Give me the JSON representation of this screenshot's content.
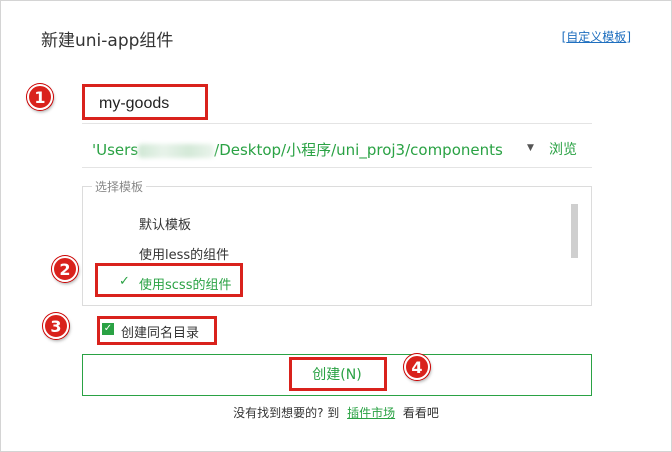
{
  "dialog": {
    "title": "新建uni-app组件",
    "custom_template_link": "自定义模板"
  },
  "component_name": {
    "value": "my-goods",
    "placeholder": ""
  },
  "location": {
    "path_prefix": "'Users",
    "path_suffix": "/Desktop/小程序/uni_proj3/components",
    "browse_label": "浏览"
  },
  "templates": {
    "legend": "选择模板",
    "items": [
      {
        "label": "默认模板",
        "selected": false
      },
      {
        "label": "使用less的组件",
        "selected": false
      },
      {
        "label": "使用scss的组件",
        "selected": true
      }
    ]
  },
  "same_name_dir": {
    "label": "创建同名目录",
    "checked": true
  },
  "create_button": {
    "label": "创建(N)"
  },
  "footer": {
    "prefix": "没有找到想要的? 到",
    "market_link": "插件市场",
    "suffix": "看看吧"
  },
  "annotations": [
    "1",
    "2",
    "3",
    "4"
  ],
  "colors": {
    "accent": "#2aa244",
    "annotation_red": "#d9221c",
    "link_blue": "#1f6fbf"
  }
}
